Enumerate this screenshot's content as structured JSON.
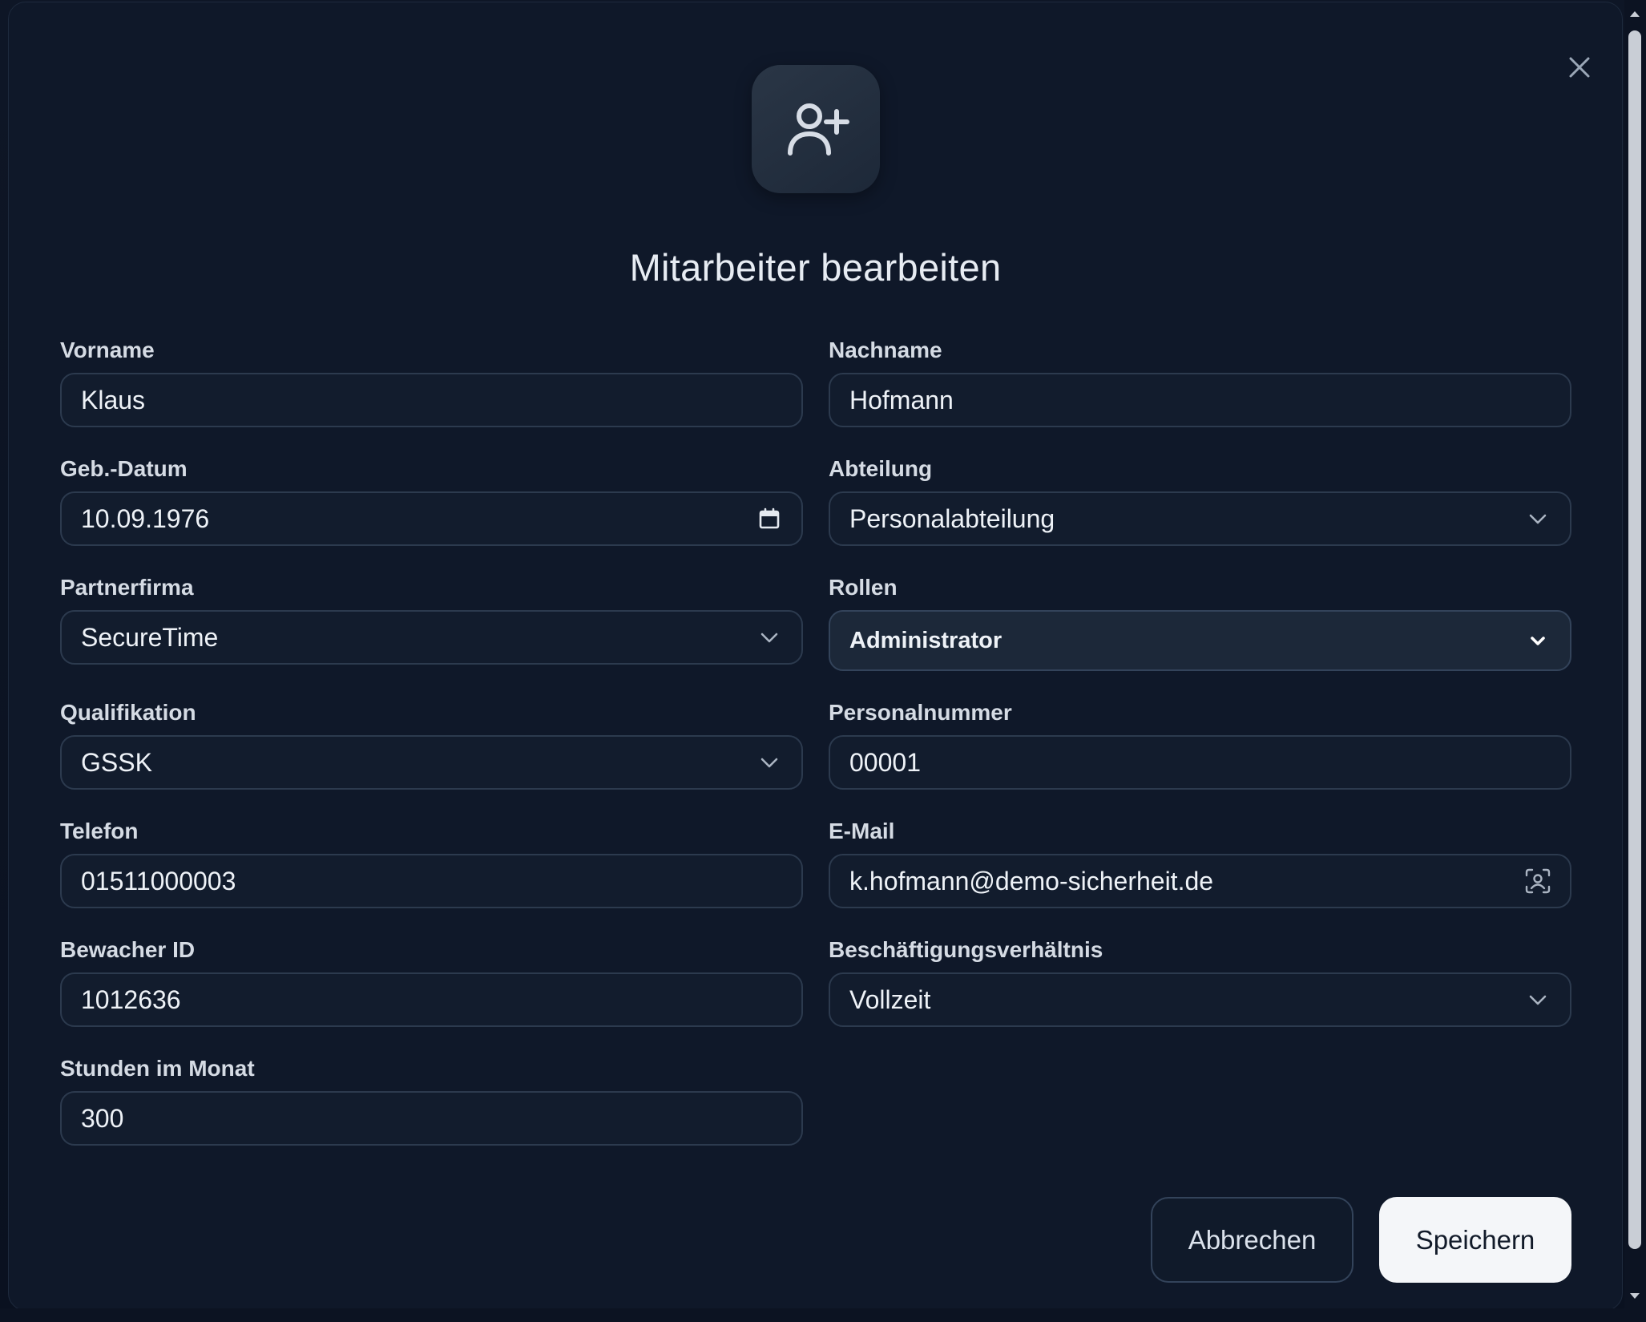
{
  "dialog": {
    "title": "Mitarbeiter bearbeiten",
    "icon": "user-plus-icon",
    "close_icon": "close-icon"
  },
  "fields": {
    "vorname": {
      "label": "Vorname",
      "value": "Klaus"
    },
    "nachname": {
      "label": "Nachname",
      "value": "Hofmann"
    },
    "geburtsdatum": {
      "label": "Geb.-Datum",
      "value": "10.09.1976",
      "icon": "calendar-icon"
    },
    "abteilung": {
      "label": "Abteilung",
      "value": "Personalabteilung",
      "icon": "chevron-down-icon"
    },
    "partnerfirma": {
      "label": "Partnerfirma",
      "value": "SecureTime",
      "icon": "chevron-down-icon"
    },
    "rollen": {
      "label": "Rollen",
      "value": "Administrator",
      "icon": "chevron-down-icon"
    },
    "qualifikation": {
      "label": "Qualifikation",
      "value": "GSSK",
      "icon": "chevron-down-icon"
    },
    "personalnummer": {
      "label": "Personalnummer",
      "value": "00001"
    },
    "telefon": {
      "label": "Telefon",
      "value": "01511000003"
    },
    "email": {
      "label": "E-Mail",
      "value": "k.hofmann@demo-sicherheit.de",
      "icon": "contact-scan-icon"
    },
    "bewacher_id": {
      "label": "Bewacher ID",
      "value": "1012636"
    },
    "beschaeftigung": {
      "label": "Beschäftigungsverhältnis",
      "value": "Vollzeit",
      "icon": "chevron-down-icon"
    },
    "stunden": {
      "label": "Stunden im Monat",
      "value": "300"
    }
  },
  "actions": {
    "cancel_label": "Abbrechen",
    "save_label": "Speichern"
  },
  "colors": {
    "background": "#0f1829",
    "field_border": "#2c3a4e",
    "text": "#eef2f7",
    "primary_button": "#f4f6f9"
  }
}
